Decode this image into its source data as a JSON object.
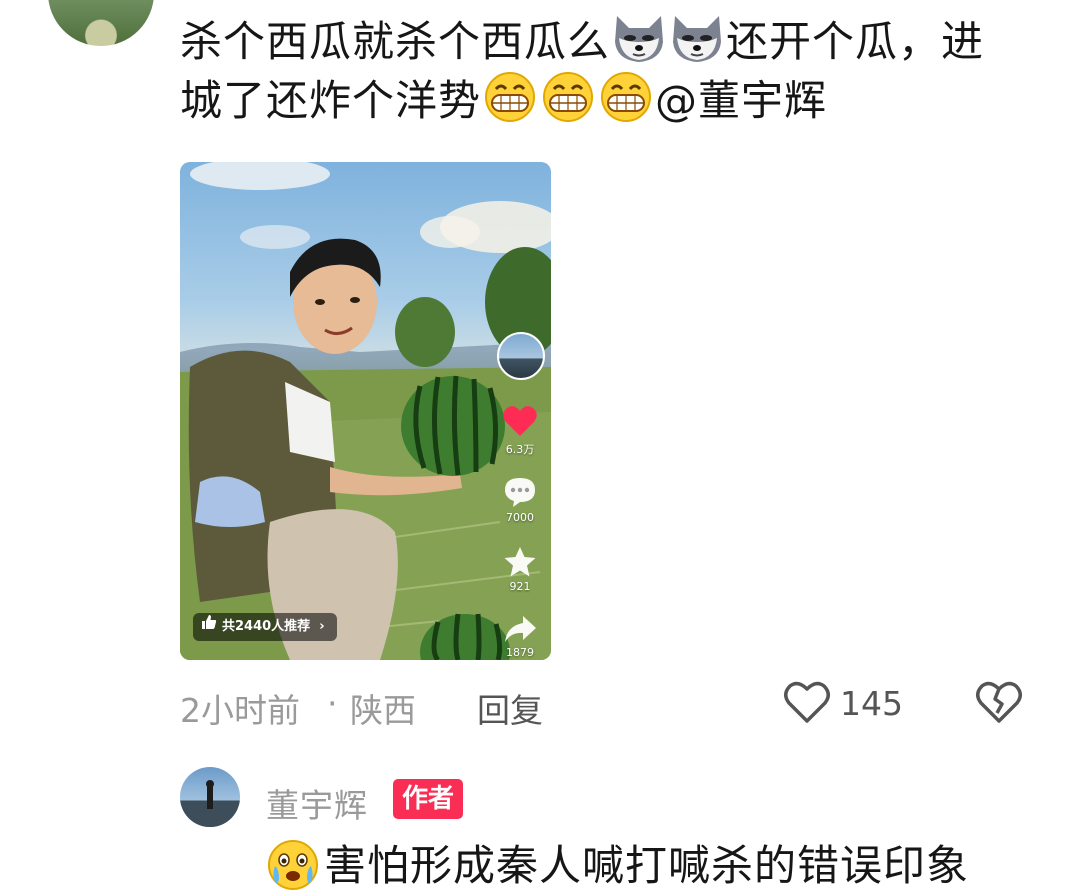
{
  "comment": {
    "line1_a": "杀个西瓜就杀个西瓜么",
    "line1_b": "还开个瓜，进",
    "line2_a": "城了还炸个洋势",
    "mention": "@董宇辉"
  },
  "video": {
    "recommend_label": "共2440人推荐",
    "likes": "6.3万",
    "comments": "7000",
    "favorites": "921",
    "shares": "1879"
  },
  "meta": {
    "time": "2小时前",
    "location": "陕西",
    "separator": "·",
    "reply_label": "回复",
    "like_count": "145"
  },
  "author_reply": {
    "name": "董宇辉",
    "badge": "作者",
    "text": "害怕形成秦人喊打喊杀的错误印象"
  },
  "icons": {
    "emoji_1": "doge-icon",
    "emoji_2": "grin-icon",
    "emoji_3": "crying-icon"
  },
  "colors": {
    "badge": "#fa2d54",
    "like_heart": "#fe2c55",
    "meta_text": "#9a9a9a"
  }
}
